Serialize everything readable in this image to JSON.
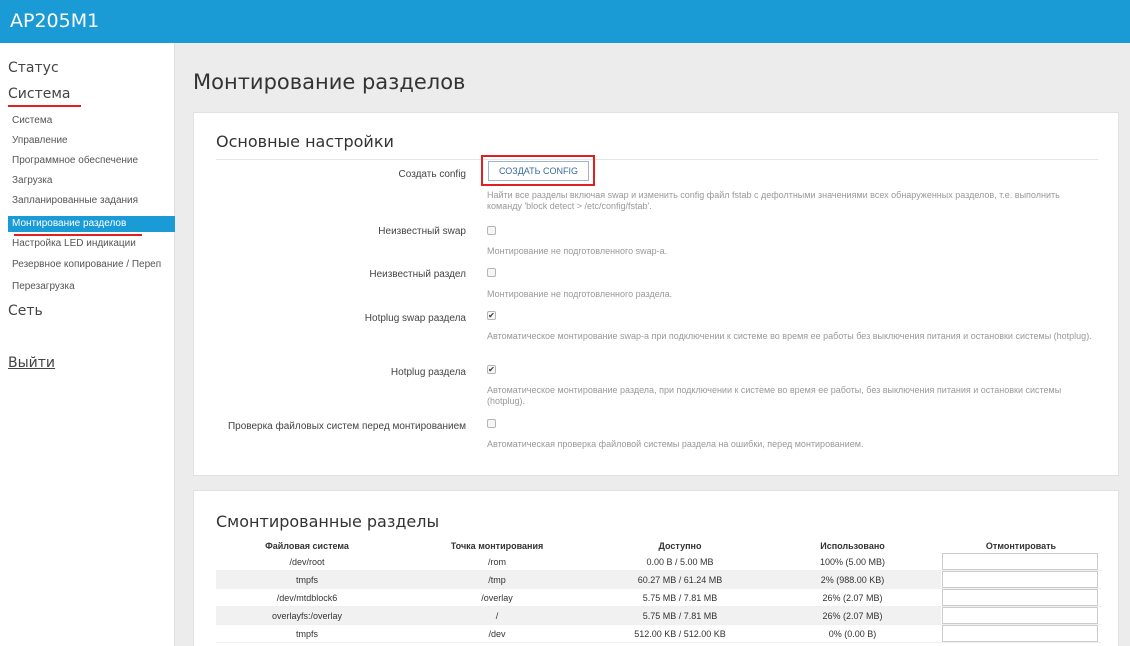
{
  "brand": "AP205M1",
  "sidebar": {
    "status": "Статус",
    "system": "Система",
    "sub_items": [
      "Система",
      "Управление",
      "Программное обеспечение",
      "Загрузка",
      "Запланированные задания",
      "Монтирование разделов",
      "Настройка LED индикации",
      "Резервное копирование / Переп",
      "Перезагрузка"
    ],
    "network": "Сеть",
    "logout": "Выйти"
  },
  "page_title": "Монтирование разделов",
  "basic": {
    "title": "Основные настройки",
    "create_config_label": "Создать config",
    "create_config_button": "СОЗДАТЬ CONFIG",
    "create_config_desc": "Найти все разделы включая swap и изменить config файл fstab с дефолтными значениями всех обнаруженных разделов, т.е. выполнить команду 'block detect > /etc/config/fstab'.",
    "rows": [
      {
        "label": "Неизвестный swap",
        "checked": false,
        "desc": "Монтирование не подготовленного swap-а."
      },
      {
        "label": "Неизвестный раздел",
        "checked": false,
        "desc": "Монтирование не подготовленного раздела."
      },
      {
        "label": "Hotplug swap раздела",
        "checked": true,
        "desc": "Автоматическое монтирование swap-а при подключении к системе во время ее работы без выключения питания и остановки системы (hotplug)."
      },
      {
        "label": "Hotplug раздела",
        "checked": true,
        "desc": "Автоматическое монтирование раздела, при подключении к системе во время ее работы, без выключения питания и остановки системы (hotplug)."
      },
      {
        "label": "Проверка файловых систем перед монтированием",
        "checked": false,
        "desc": "Автоматическая проверка файловой системы раздела на ошибки, перед монтированием."
      }
    ]
  },
  "mounted": {
    "title": "Смонтированные разделы",
    "headers": [
      "Файловая система",
      "Точка монтирования",
      "Доступно",
      "Использовано",
      "Отмонтировать"
    ],
    "rows": [
      [
        "/dev/root",
        "/rom",
        "0.00 B / 5.00 MB",
        "100% (5.00 MB)"
      ],
      [
        "tmpfs",
        "/tmp",
        "60.27 MB / 61.24 MB",
        "2% (988.00 KB)"
      ],
      [
        "/dev/mtdblock6",
        "/overlay",
        "5.75 MB / 7.81 MB",
        "26% (2.07 MB)"
      ],
      [
        "overlayfs:/overlay",
        "/",
        "5.75 MB / 7.81 MB",
        "26% (2.07 MB)"
      ],
      [
        "tmpfs",
        "/dev",
        "512.00 KB / 512.00 KB",
        "0% (0.00 B)"
      ]
    ]
  }
}
